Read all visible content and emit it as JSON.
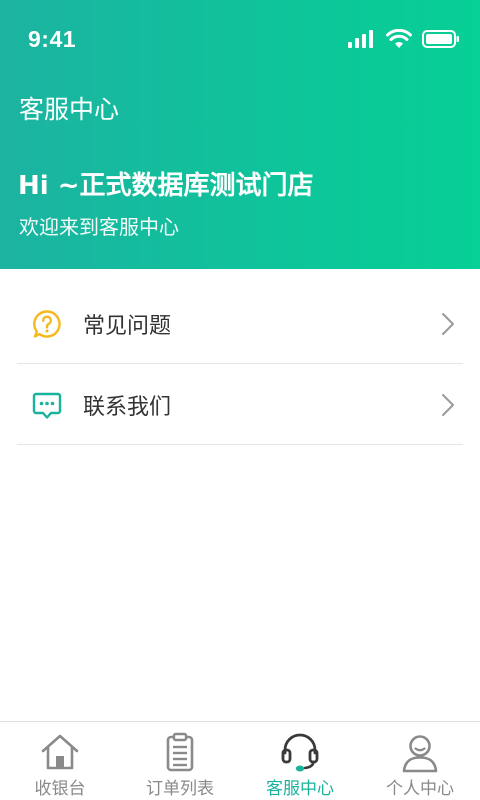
{
  "status_bar": {
    "time": "9:41"
  },
  "header": {
    "title": "客服中心",
    "greeting": "Hi ~正式数据库测试门店",
    "subtitle": "欢迎来到客服中心"
  },
  "menu": {
    "items": [
      {
        "label": "常见问题",
        "icon": "question-bubble-icon"
      },
      {
        "label": "联系我们",
        "icon": "chat-bubble-icon"
      }
    ]
  },
  "tabbar": {
    "items": [
      {
        "label": "收银台",
        "icon": "home-icon"
      },
      {
        "label": "订单列表",
        "icon": "clipboard-icon"
      },
      {
        "label": "客服中心",
        "icon": "headset-icon",
        "active": true
      },
      {
        "label": "个人中心",
        "icon": "person-icon"
      }
    ]
  },
  "colors": {
    "header_start": "#1cb3a1",
    "header_end": "#06d095",
    "accent": "#19b39c",
    "faq_icon": "#f5b91c",
    "contact_icon": "#19b39c"
  }
}
